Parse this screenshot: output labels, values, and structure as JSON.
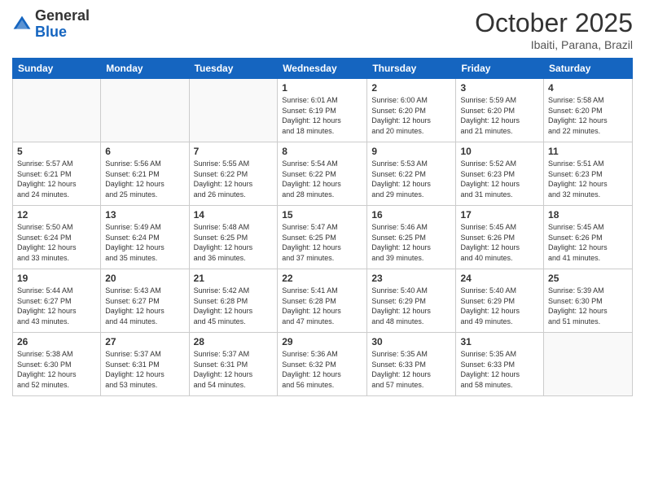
{
  "header": {
    "logo_general": "General",
    "logo_blue": "Blue",
    "month": "October 2025",
    "location": "Ibaiti, Parana, Brazil"
  },
  "days_of_week": [
    "Sunday",
    "Monday",
    "Tuesday",
    "Wednesday",
    "Thursday",
    "Friday",
    "Saturday"
  ],
  "weeks": [
    [
      {
        "day": "",
        "info": ""
      },
      {
        "day": "",
        "info": ""
      },
      {
        "day": "",
        "info": ""
      },
      {
        "day": "1",
        "info": "Sunrise: 6:01 AM\nSunset: 6:19 PM\nDaylight: 12 hours\nand 18 minutes."
      },
      {
        "day": "2",
        "info": "Sunrise: 6:00 AM\nSunset: 6:20 PM\nDaylight: 12 hours\nand 20 minutes."
      },
      {
        "day": "3",
        "info": "Sunrise: 5:59 AM\nSunset: 6:20 PM\nDaylight: 12 hours\nand 21 minutes."
      },
      {
        "day": "4",
        "info": "Sunrise: 5:58 AM\nSunset: 6:20 PM\nDaylight: 12 hours\nand 22 minutes."
      }
    ],
    [
      {
        "day": "5",
        "info": "Sunrise: 5:57 AM\nSunset: 6:21 PM\nDaylight: 12 hours\nand 24 minutes."
      },
      {
        "day": "6",
        "info": "Sunrise: 5:56 AM\nSunset: 6:21 PM\nDaylight: 12 hours\nand 25 minutes."
      },
      {
        "day": "7",
        "info": "Sunrise: 5:55 AM\nSunset: 6:22 PM\nDaylight: 12 hours\nand 26 minutes."
      },
      {
        "day": "8",
        "info": "Sunrise: 5:54 AM\nSunset: 6:22 PM\nDaylight: 12 hours\nand 28 minutes."
      },
      {
        "day": "9",
        "info": "Sunrise: 5:53 AM\nSunset: 6:22 PM\nDaylight: 12 hours\nand 29 minutes."
      },
      {
        "day": "10",
        "info": "Sunrise: 5:52 AM\nSunset: 6:23 PM\nDaylight: 12 hours\nand 31 minutes."
      },
      {
        "day": "11",
        "info": "Sunrise: 5:51 AM\nSunset: 6:23 PM\nDaylight: 12 hours\nand 32 minutes."
      }
    ],
    [
      {
        "day": "12",
        "info": "Sunrise: 5:50 AM\nSunset: 6:24 PM\nDaylight: 12 hours\nand 33 minutes."
      },
      {
        "day": "13",
        "info": "Sunrise: 5:49 AM\nSunset: 6:24 PM\nDaylight: 12 hours\nand 35 minutes."
      },
      {
        "day": "14",
        "info": "Sunrise: 5:48 AM\nSunset: 6:25 PM\nDaylight: 12 hours\nand 36 minutes."
      },
      {
        "day": "15",
        "info": "Sunrise: 5:47 AM\nSunset: 6:25 PM\nDaylight: 12 hours\nand 37 minutes."
      },
      {
        "day": "16",
        "info": "Sunrise: 5:46 AM\nSunset: 6:25 PM\nDaylight: 12 hours\nand 39 minutes."
      },
      {
        "day": "17",
        "info": "Sunrise: 5:45 AM\nSunset: 6:26 PM\nDaylight: 12 hours\nand 40 minutes."
      },
      {
        "day": "18",
        "info": "Sunrise: 5:45 AM\nSunset: 6:26 PM\nDaylight: 12 hours\nand 41 minutes."
      }
    ],
    [
      {
        "day": "19",
        "info": "Sunrise: 5:44 AM\nSunset: 6:27 PM\nDaylight: 12 hours\nand 43 minutes."
      },
      {
        "day": "20",
        "info": "Sunrise: 5:43 AM\nSunset: 6:27 PM\nDaylight: 12 hours\nand 44 minutes."
      },
      {
        "day": "21",
        "info": "Sunrise: 5:42 AM\nSunset: 6:28 PM\nDaylight: 12 hours\nand 45 minutes."
      },
      {
        "day": "22",
        "info": "Sunrise: 5:41 AM\nSunset: 6:28 PM\nDaylight: 12 hours\nand 47 minutes."
      },
      {
        "day": "23",
        "info": "Sunrise: 5:40 AM\nSunset: 6:29 PM\nDaylight: 12 hours\nand 48 minutes."
      },
      {
        "day": "24",
        "info": "Sunrise: 5:40 AM\nSunset: 6:29 PM\nDaylight: 12 hours\nand 49 minutes."
      },
      {
        "day": "25",
        "info": "Sunrise: 5:39 AM\nSunset: 6:30 PM\nDaylight: 12 hours\nand 51 minutes."
      }
    ],
    [
      {
        "day": "26",
        "info": "Sunrise: 5:38 AM\nSunset: 6:30 PM\nDaylight: 12 hours\nand 52 minutes."
      },
      {
        "day": "27",
        "info": "Sunrise: 5:37 AM\nSunset: 6:31 PM\nDaylight: 12 hours\nand 53 minutes."
      },
      {
        "day": "28",
        "info": "Sunrise: 5:37 AM\nSunset: 6:31 PM\nDaylight: 12 hours\nand 54 minutes."
      },
      {
        "day": "29",
        "info": "Sunrise: 5:36 AM\nSunset: 6:32 PM\nDaylight: 12 hours\nand 56 minutes."
      },
      {
        "day": "30",
        "info": "Sunrise: 5:35 AM\nSunset: 6:33 PM\nDaylight: 12 hours\nand 57 minutes."
      },
      {
        "day": "31",
        "info": "Sunrise: 5:35 AM\nSunset: 6:33 PM\nDaylight: 12 hours\nand 58 minutes."
      },
      {
        "day": "",
        "info": ""
      }
    ]
  ]
}
